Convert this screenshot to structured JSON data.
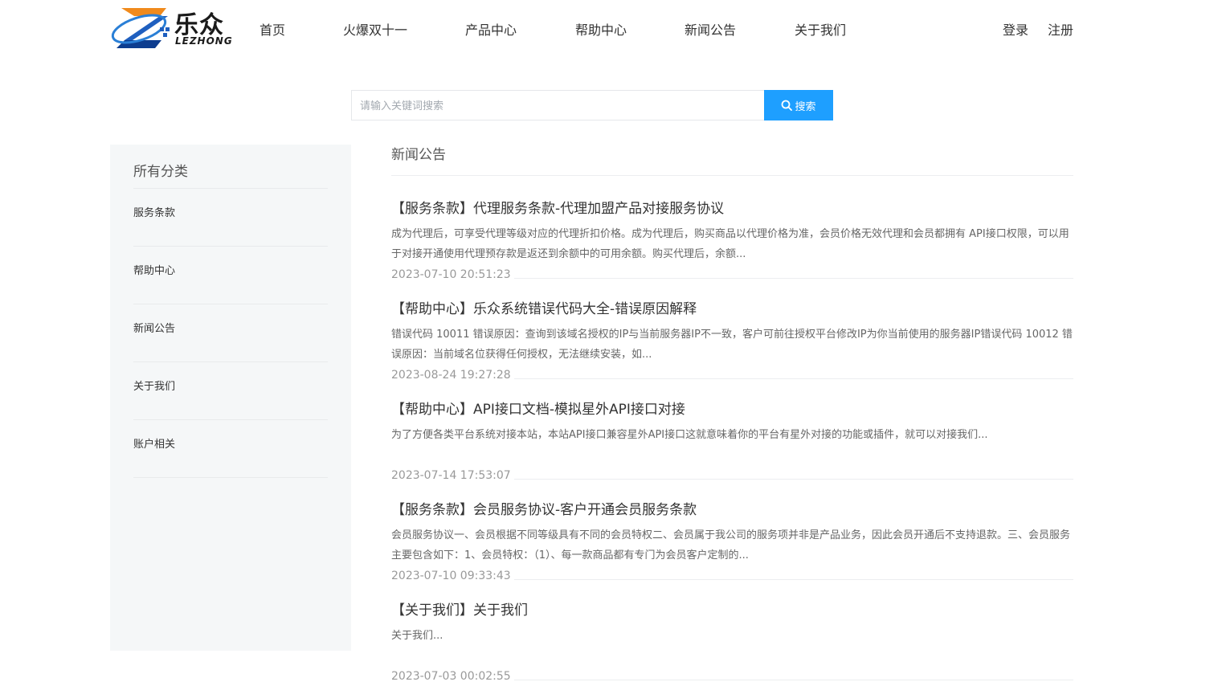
{
  "logo": {
    "cn": "乐众",
    "en": "LEZHONG"
  },
  "nav": [
    "首页",
    "火爆双十一",
    "产品中心",
    "帮助中心",
    "新闻公告",
    "关于我们"
  ],
  "auth": {
    "login": "登录",
    "register": "注册"
  },
  "search": {
    "placeholder": "请输入关键词搜索",
    "button_label": "搜索"
  },
  "sidebar": {
    "title": "所有分类",
    "items": [
      "服务条款",
      "帮助中心",
      "新闻公告",
      "关于我们",
      "账户相关"
    ]
  },
  "main": {
    "title": "新闻公告",
    "articles": [
      {
        "title": "【服务条款】代理服务条款-代理加盟产品对接服务协议",
        "desc": "成为代理后，可享受代理等级对应的代理折扣价格。成为代理后，购买商品以代理价格为准，会员价格无效代理和会员都拥有 API接口权限，可以用于对接开通使用代理预存款是返还到余额中的可用余额。购买代理后，余额...",
        "date": "2023-07-10 20:51:23"
      },
      {
        "title": "【帮助中心】乐众系统错误代码大全-错误原因解释",
        "desc": "错误代码 10011 错误原因：查询到该域名授权的IP与当前服务器IP不一致，客户可前往授权平台修改IP为你当前使用的服务器IP错误代码 10012 错误原因：当前域名位获得任何授权，无法继续安装，如...",
        "date": "2023-08-24 19:27:28"
      },
      {
        "title": "【帮助中心】API接口文档-模拟星外API接口对接",
        "desc": "为了方便各类平台系统对接本站，本站API接口兼容星外API接口这就意味着你的平台有星外对接的功能或插件，就可以对接我们...",
        "date": "2023-07-14 17:53:07"
      },
      {
        "title": "【服务条款】会员服务协议-客户开通会员服务条款",
        "desc": "会员服务协议一、会员根据不同等级具有不同的会员特权二、会员属于我公司的服务项并非是产品业务，因此会员开通后不支持退款。三、会员服务主要包含如下：1、会员特权：（1）、每一款商品都有专门为会员客户定制的...",
        "date": "2023-07-10 09:33:43"
      },
      {
        "title": "【关于我们】关于我们",
        "desc": "关于我们...",
        "date": "2023-07-03 00:02:55"
      }
    ]
  },
  "colors": {
    "accent": "#1e9fff",
    "logo_blue": "#1f5fbf",
    "logo_orange": "#f08a1c"
  }
}
